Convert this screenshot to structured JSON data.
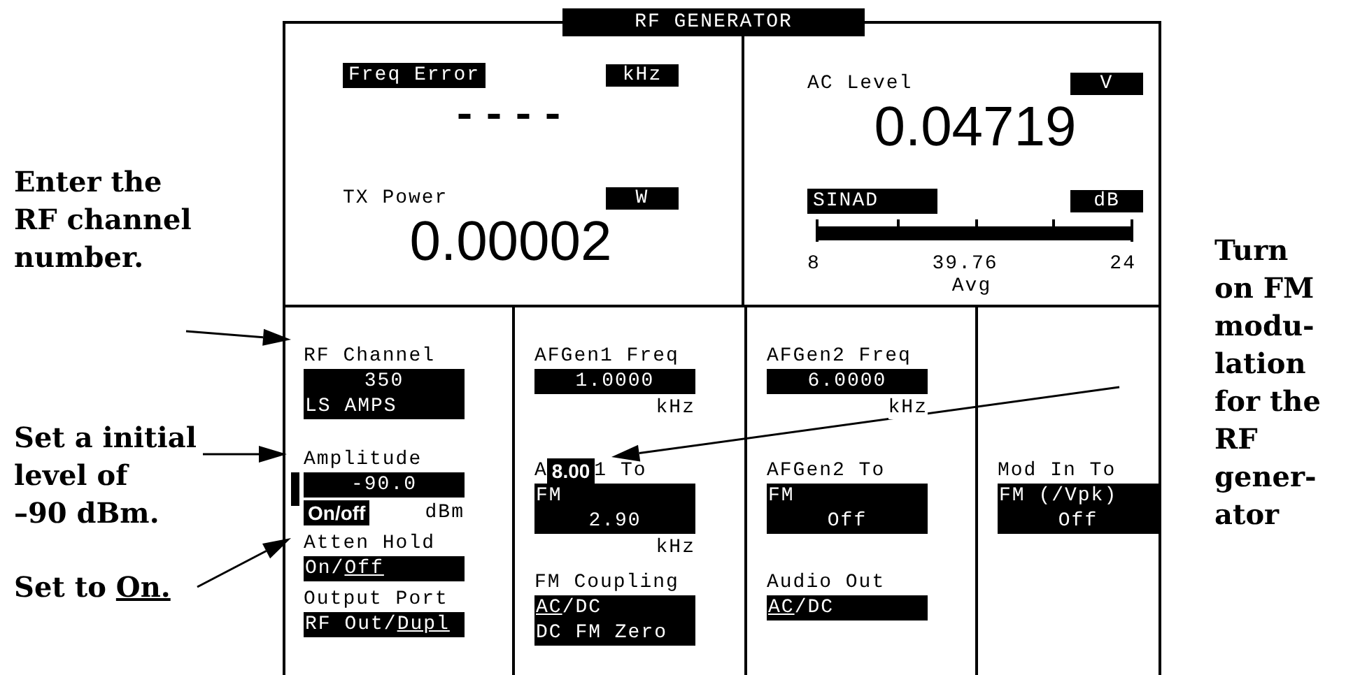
{
  "left_notes": [
    {
      "lines": [
        "Enter the",
        "RF channel",
        "number."
      ]
    },
    {
      "lines": [
        "Set a initial",
        "level of",
        "–90 dBm."
      ]
    },
    {
      "segments": [
        {
          "text": "Set to ",
          "underlined": false
        },
        {
          "text": "On.",
          "underlined": true
        }
      ]
    }
  ],
  "screen": {
    "title": "RF GENERATOR",
    "top_panels": [
      {
        "items": [
          {
            "kind": "readout",
            "label": "Freq Error",
            "label_inverse": true,
            "unit": "kHz",
            "value": "----"
          },
          {
            "kind": "readout",
            "label": "TX Power",
            "label_inverse": false,
            "unit": "W",
            "value": "0.00002"
          }
        ]
      },
      {
        "items": [
          {
            "kind": "readout",
            "label": "AC Level",
            "label_inverse": false,
            "unit": "V",
            "value": "0.04719"
          },
          {
            "kind": "meter",
            "label": "SINAD",
            "unit": "dB",
            "level": 1,
            "scale_min": "8",
            "reading": "39.76",
            "scale_max": "24",
            "detector": "Avg"
          }
        ]
      }
    ],
    "columns": [
      {
        "fields": [
          {
            "label": "RF Channel",
            "focused": false,
            "rows": [
              {
                "kind": "value",
                "text": "350"
              },
              {
                "kind": "setting",
                "text": "LS AMPS"
              }
            ]
          },
          {
            "label": "Amplitude",
            "focused": true,
            "rows": [
              {
                "kind": "value",
                "text": "-90.0"
              }
            ],
            "unit_callout": "On/off",
            "unit": "dBm"
          },
          {
            "label": "Atten Hold",
            "focused": false,
            "rows": [
              {
                "kind": "choice",
                "segments": [
                  {
                    "text": "On/",
                    "selected": false
                  },
                  {
                    "text": "Off",
                    "selected": true
                  }
                ]
              }
            ]
          },
          {
            "label": "Output Port",
            "focused": false,
            "rows": [
              {
                "kind": "choice",
                "segments": [
                  {
                    "text": "RF Out/",
                    "selected": false
                  },
                  {
                    "text": "Dupl",
                    "selected": true
                  }
                ]
              }
            ]
          }
        ]
      },
      {
        "fields": [
          {
            "label": "AFGen1 Freq",
            "focused": false,
            "rows": [
              {
                "kind": "value",
                "text": "1.0000"
              }
            ],
            "unit": "kHz"
          },
          {
            "label_segments": [
              {
                "kind": "text",
                "text": "A"
              },
              {
                "kind": "callout",
                "text": "8.00"
              },
              {
                "kind": "text",
                "text": "1 To"
              }
            ],
            "focused": false,
            "rows": [
              {
                "kind": "setting",
                "text": "FM"
              },
              {
                "kind": "value",
                "text": "2.90"
              }
            ],
            "unit": "kHz"
          },
          {
            "label": "FM Coupling",
            "focused": false,
            "rows": [
              {
                "kind": "choice",
                "segments": [
                  {
                    "text": "AC",
                    "selected": true
                  },
                  {
                    "text": "/DC",
                    "selected": false
                  }
                ]
              },
              {
                "kind": "setting",
                "text": "DC FM Zero"
              }
            ]
          }
        ]
      },
      {
        "fields": [
          {
            "label": "AFGen2 Freq",
            "focused": false,
            "rows": [
              {
                "kind": "value",
                "text": "6.0000"
              }
            ],
            "unit": "kHz"
          },
          {
            "label": "AFGen2 To",
            "focused": false,
            "rows": [
              {
                "kind": "setting",
                "text": "FM"
              },
              {
                "kind": "value",
                "text": "Off"
              }
            ]
          },
          {
            "label": "Audio Out",
            "focused": false,
            "rows": [
              {
                "kind": "choice",
                "segments": [
                  {
                    "text": "AC",
                    "selected": true
                  },
                  {
                    "text": "/DC",
                    "selected": false
                  }
                ]
              }
            ]
          }
        ]
      },
      {
        "fields": [
          {
            "label": "Mod In To",
            "focused": false,
            "rows": [
              {
                "kind": "setting",
                "text": "FM (/Vpk)"
              },
              {
                "kind": "value",
                "text": "Off"
              }
            ]
          }
        ]
      }
    ]
  },
  "right_note": {
    "lines": [
      "Turn",
      "on FM",
      "modu-",
      "lation",
      "for the",
      "RF",
      "gener-",
      "ator"
    ]
  }
}
